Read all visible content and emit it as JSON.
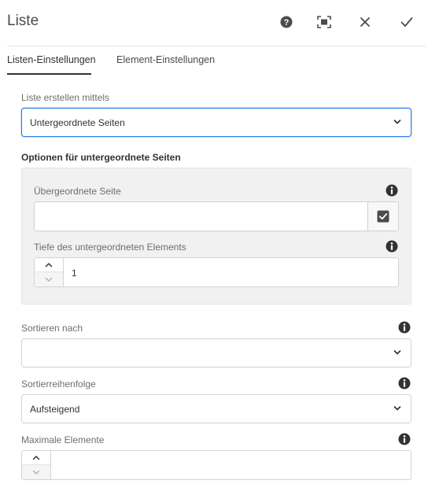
{
  "header": {
    "title": "Liste",
    "icons": [
      "help-icon",
      "fullscreen-icon",
      "close-icon",
      "checkmark-icon"
    ]
  },
  "tabs": [
    {
      "label": "Listen-Einstellungen",
      "active": true
    },
    {
      "label": "Element-Einstellungen",
      "active": false
    }
  ],
  "form": {
    "build_list_label": "Liste erstellen mittels",
    "build_list_value": "Untergeordnete Seiten",
    "child_options_heading": "Optionen für untergeordnete Seiten",
    "parent_page_label": "Übergeordnete Seite",
    "parent_page_value": "",
    "depth_label": "Tiefe des untergeordneten Elements",
    "depth_value": "1",
    "order_by_label": "Sortieren nach",
    "order_by_value": "",
    "sort_order_label": "Sortierreihenfolge",
    "sort_order_value": "Aufsteigend",
    "max_items_label": "Maximale Elemente",
    "max_items_value": ""
  },
  "colors": {
    "focus_border": "#2680eb",
    "text": "#323232",
    "panel_bg": "#f1f1f1"
  }
}
